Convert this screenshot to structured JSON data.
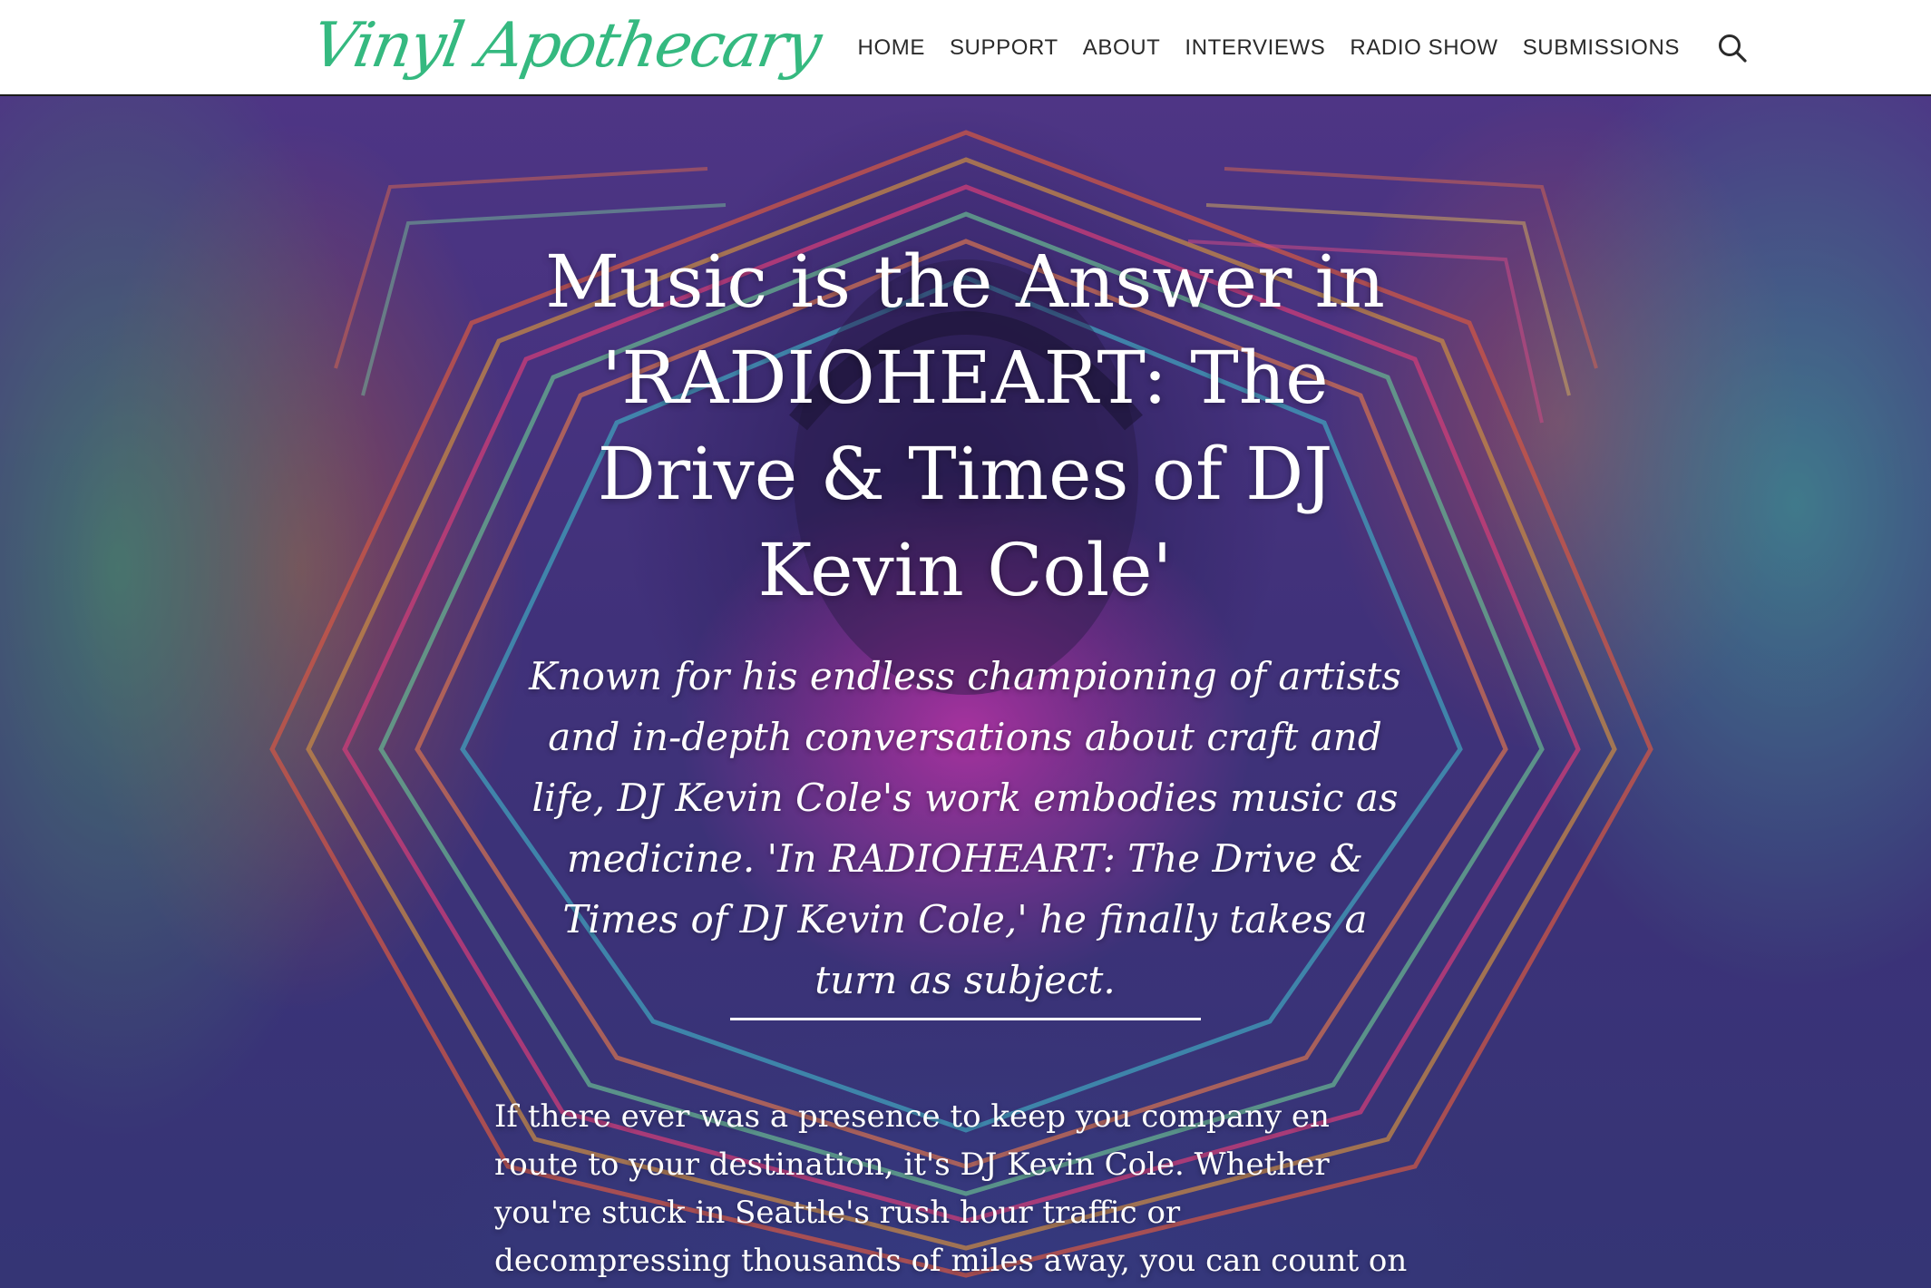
{
  "site": {
    "logo_text": "Vinyl Apothecary",
    "brand_color": "#35b980"
  },
  "nav": {
    "items": [
      {
        "label": "HOME"
      },
      {
        "label": "SUPPORT"
      },
      {
        "label": "ABOUT"
      },
      {
        "label": "INTERVIEWS"
      },
      {
        "label": "RADIO SHOW"
      },
      {
        "label": "SUBMISSIONS"
      }
    ],
    "search_icon": "search-icon"
  },
  "article": {
    "title": "Music is the Answer in 'RADIOHEART: The Drive & Times of DJ Kevin Cole'",
    "subtitle": "Known for his endless championing of artists and in-depth conversations about craft and life, DJ Kevin Cole's work embodies music as medicine. 'In RADIOHEART: The Drive & Times of DJ Kevin Cole,' he finally takes a turn as subject.",
    "intro": "If there ever was a presence to keep you company en route to your destination, it's DJ Kevin Cole. Whether you're stuck in Seattle's rush hour traffic or decompressing thousands of miles away, you can count on Kevin to be your musical tour guide."
  }
}
